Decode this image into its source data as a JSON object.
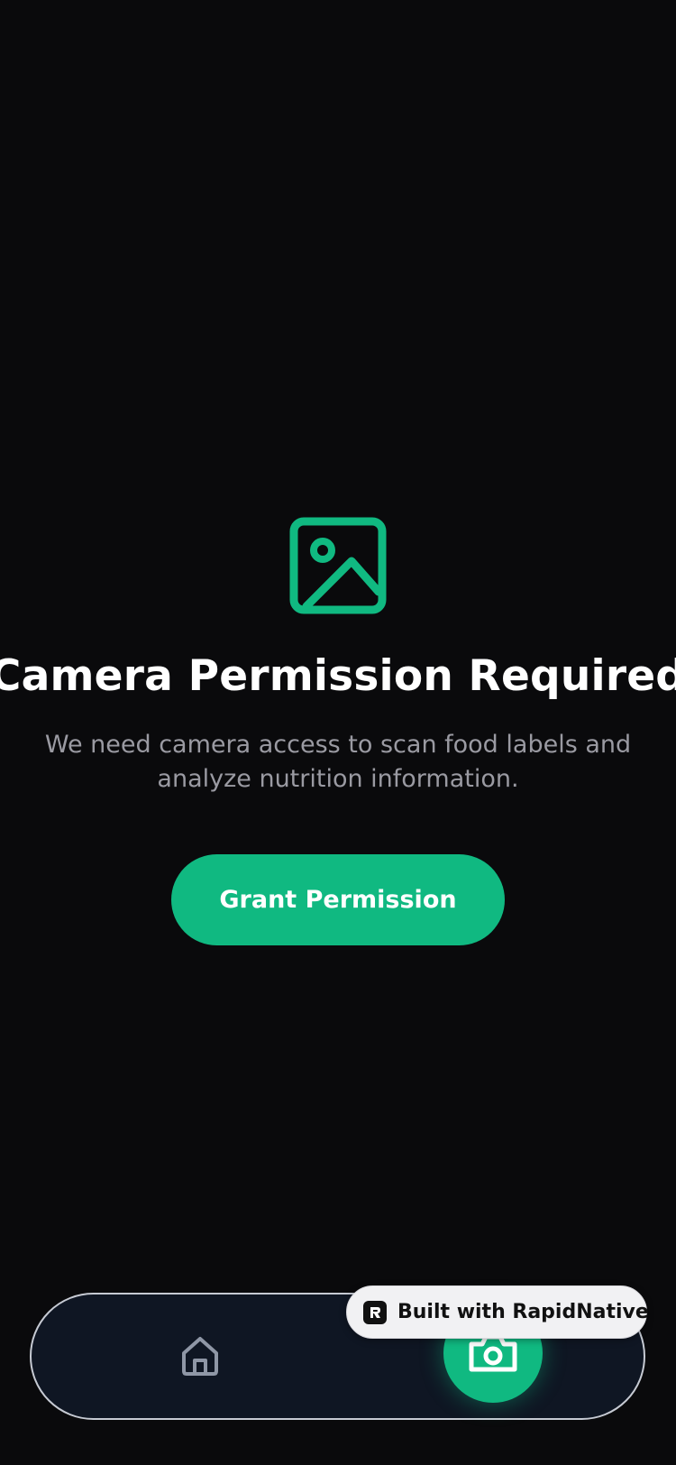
{
  "permission": {
    "icon": "image-icon",
    "title": "Camera Permission Required",
    "description": "We need camera access to scan food labels and analyze nutrition information.",
    "button_label": "Grant Permission"
  },
  "tabbar": {
    "items": [
      {
        "icon": "home-icon",
        "active": false
      },
      {
        "icon": "camera-icon",
        "active": true
      }
    ]
  },
  "badge": {
    "label": "Built with RapidNative",
    "icon": "rapidnative-logo"
  },
  "colors": {
    "background": "#0a0a0c",
    "accent": "#10b981",
    "text_primary": "#ffffff",
    "text_secondary": "#9a9aa2",
    "tabbar_background": "#0f1623",
    "home_icon": "#8f97a6"
  }
}
